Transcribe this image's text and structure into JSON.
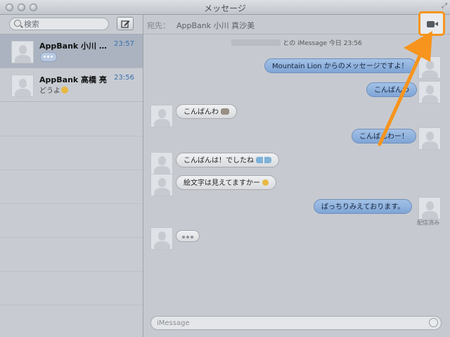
{
  "window": {
    "title": "メッセージ"
  },
  "sidebar": {
    "search": {
      "placeholder": "検索",
      "value": ""
    },
    "compose_icon": "compose-icon",
    "conversations": [
      {
        "name": "AppBank 小川 真…",
        "time": "23:57",
        "preview": "",
        "typing": true,
        "selected": true
      },
      {
        "name": "AppBank 高橋 亮",
        "time": "23:56",
        "preview": "どうよ",
        "typing": false,
        "selected": false
      }
    ]
  },
  "header": {
    "to_label": "宛先：",
    "to_name": "AppBank 小川 真沙美",
    "video_icon": "video-camera-icon"
  },
  "session": {
    "text": "との iMessage 今日 23:56"
  },
  "messages": [
    {
      "side": "out",
      "text": "Mountain Lion からのメッセージですよ！"
    },
    {
      "side": "out",
      "text": "こんばんわ"
    },
    {
      "side": "in",
      "text": "こんばんわ"
    },
    {
      "side": "out",
      "text": "こんばんわー！"
    },
    {
      "side": "in",
      "text": "こんばんは！でしたね"
    },
    {
      "side": "in",
      "text": "絵文字は見えてますかー"
    },
    {
      "side": "out",
      "text": "ばっちりみえております。"
    }
  ],
  "delivered": "配信済み",
  "composer": {
    "placeholder": "iMessage"
  },
  "accent": {
    "highlight": "#f7941d",
    "bubble_out": "#7fa5d6",
    "time": "#3a6fb0"
  }
}
